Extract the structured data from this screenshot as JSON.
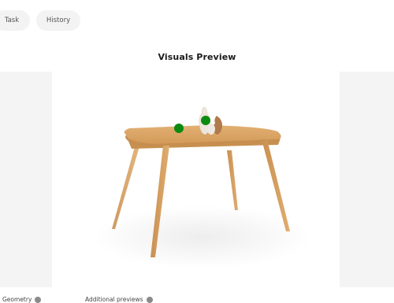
{
  "tabs": [
    {
      "label": "Task"
    },
    {
      "label": "History"
    }
  ],
  "preview": {
    "title": "Visuals Preview",
    "markers": [
      {
        "color": "#0b8a12"
      },
      {
        "color": "#0b8a12"
      }
    ]
  },
  "footer": {
    "geometry_label": "Geometry",
    "additional_label": "Additional previews"
  },
  "colors": {
    "panel_bg": "#f4f4f4",
    "tab_bg": "#f3f3f3",
    "table_top": "#d9a566",
    "table_leg": "#d4a162",
    "marker": "#0b8a12"
  }
}
